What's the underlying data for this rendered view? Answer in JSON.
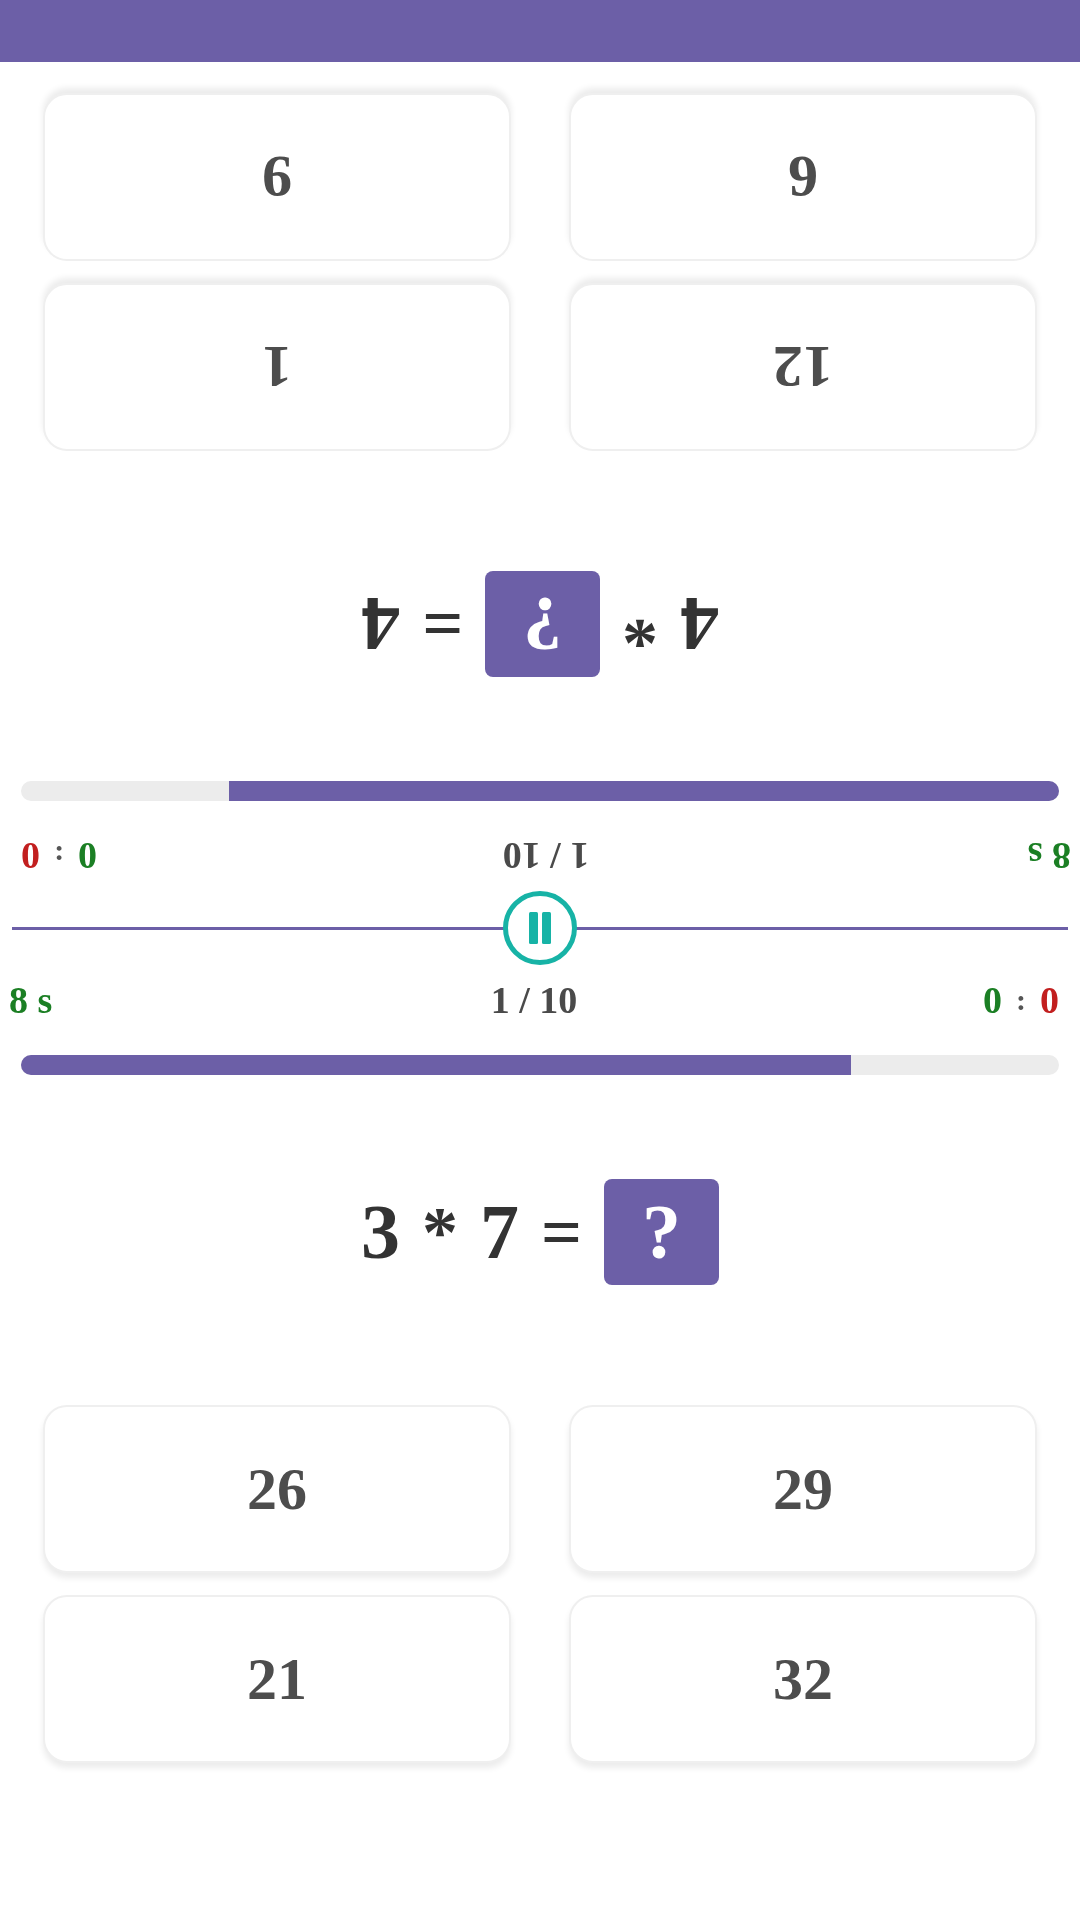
{
  "players": [
    {
      "flipped": true,
      "status": {
        "timer": "8 s",
        "round": "1 / 10",
        "score": {
          "correct": "0",
          "separator": ":",
          "wrong": "0"
        }
      },
      "time_bar": {
        "level": 0.8
      },
      "equation": [
        {
          "kind": "number",
          "text": "4"
        },
        {
          "kind": "operator",
          "text": "*"
        },
        {
          "kind": "unknown",
          "text": "?"
        },
        {
          "kind": "operator",
          "text": "="
        },
        {
          "kind": "number",
          "text": "4"
        }
      ],
      "answers": [
        "12",
        "1",
        "6",
        "9"
      ]
    },
    {
      "flipped": false,
      "status": {
        "timer": "8 s",
        "round": "1 / 10",
        "score": {
          "correct": "0",
          "separator": ":",
          "wrong": "0"
        }
      },
      "time_bar": {
        "level": 0.8
      },
      "equation": [
        {
          "kind": "number",
          "text": "3"
        },
        {
          "kind": "operator",
          "text": "*"
        },
        {
          "kind": "number",
          "text": "7"
        },
        {
          "kind": "operator",
          "text": "="
        },
        {
          "kind": "unknown",
          "text": "?"
        }
      ],
      "answers": [
        "26",
        "29",
        "21",
        "32"
      ]
    }
  ]
}
